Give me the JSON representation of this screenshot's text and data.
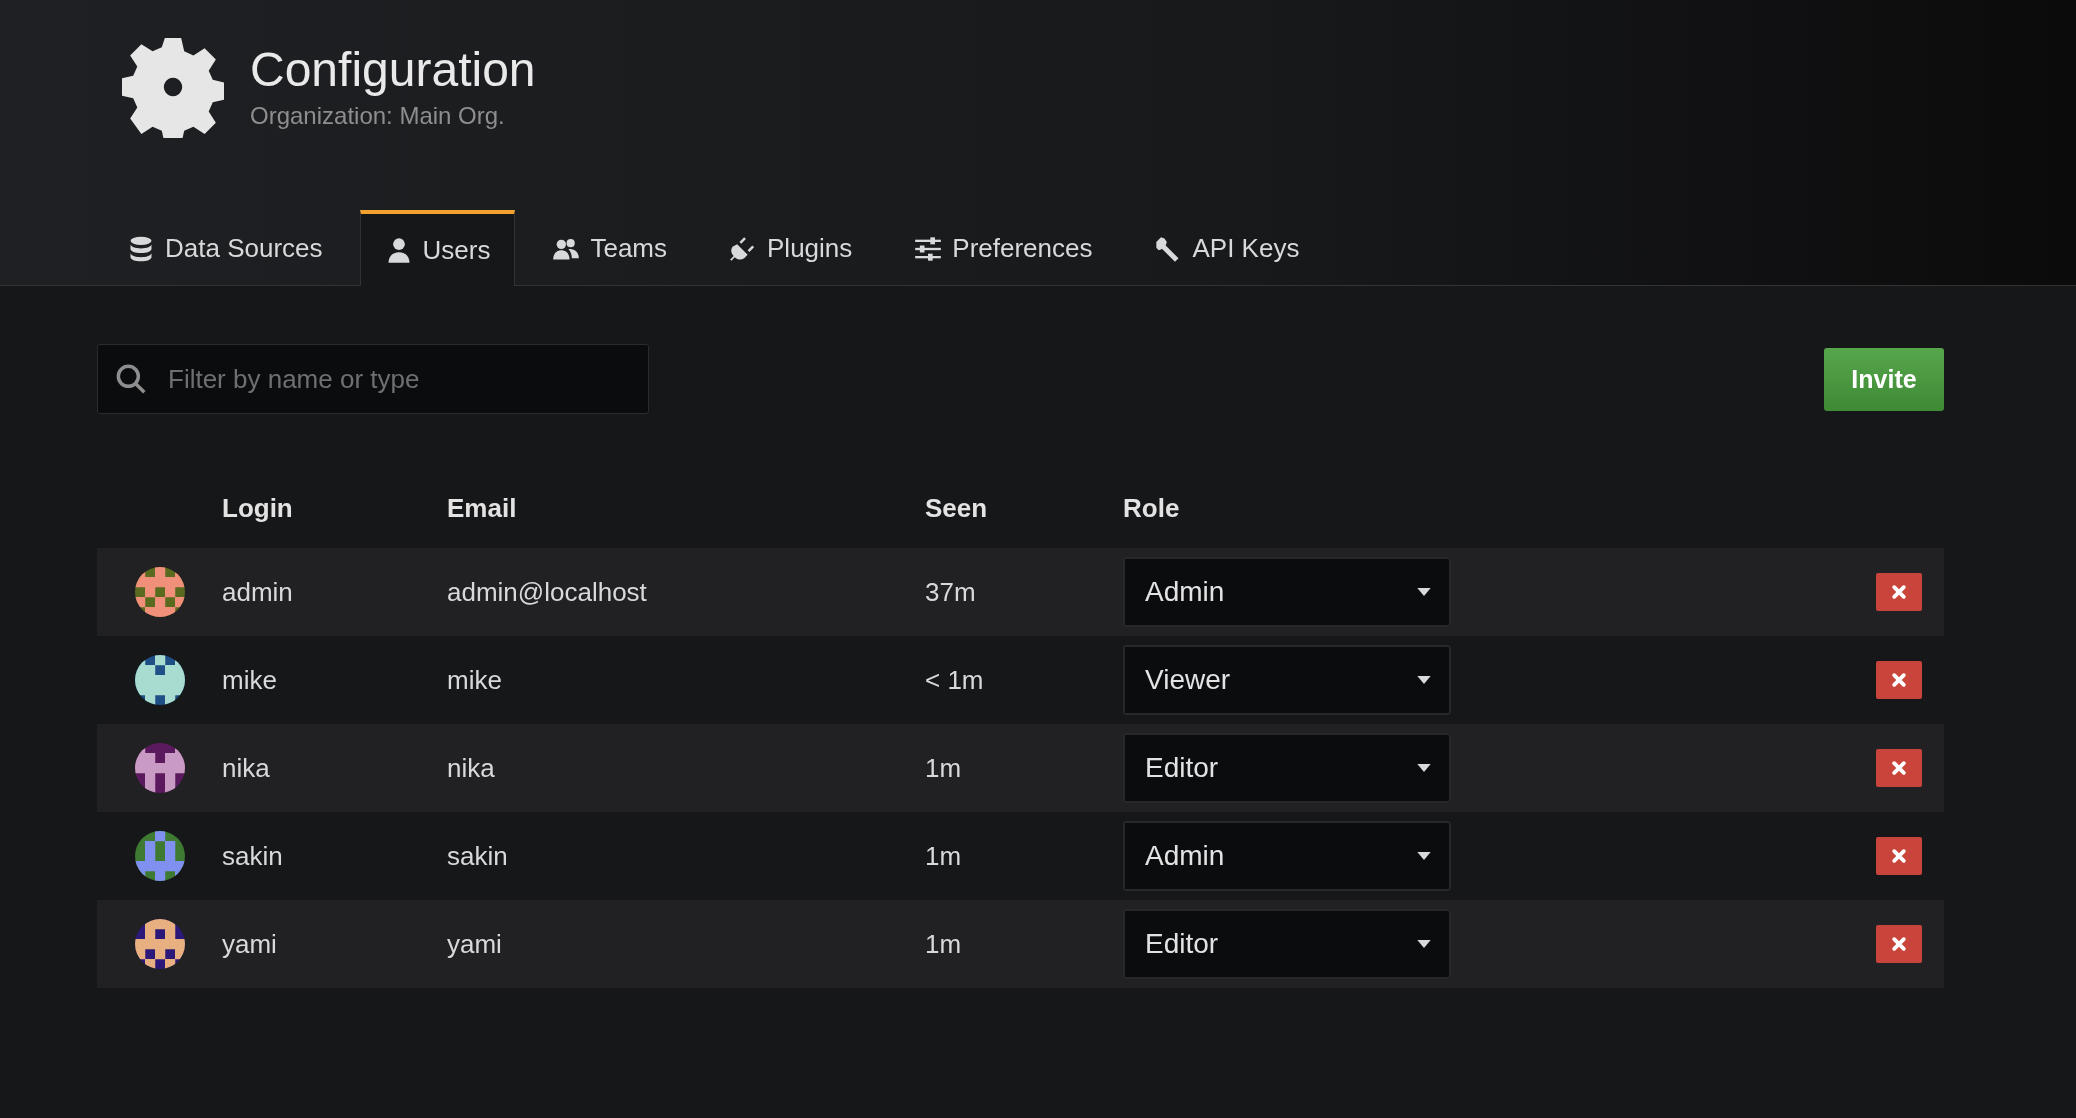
{
  "header": {
    "title": "Configuration",
    "subtitle": "Organization: Main Org."
  },
  "tabs": [
    {
      "label": "Data Sources",
      "kind": "database",
      "selected": false
    },
    {
      "label": "Users",
      "kind": "user",
      "selected": true
    },
    {
      "label": "Teams",
      "kind": "users",
      "selected": false
    },
    {
      "label": "Plugins",
      "kind": "plug",
      "selected": false
    },
    {
      "label": "Preferences",
      "kind": "sliders",
      "selected": false
    },
    {
      "label": "API Keys",
      "kind": "key",
      "selected": false
    }
  ],
  "search": {
    "placeholder": "Filter by name or type"
  },
  "invite_button": "Invite",
  "table": {
    "columns": [
      "Login",
      "Email",
      "Seen",
      "Role"
    ],
    "rows": [
      {
        "login": "admin",
        "email": "admin@localhost",
        "seen": "37m",
        "role": "Admin"
      },
      {
        "login": "mike",
        "email": "mike",
        "seen": "< 1m",
        "role": "Viewer"
      },
      {
        "login": "nika",
        "email": "nika",
        "seen": "1m",
        "role": "Editor"
      },
      {
        "login": "sakin",
        "email": "sakin",
        "seen": "1m",
        "role": "Admin"
      },
      {
        "login": "yami",
        "email": "yami",
        "seen": "1m",
        "role": "Editor"
      }
    ]
  }
}
